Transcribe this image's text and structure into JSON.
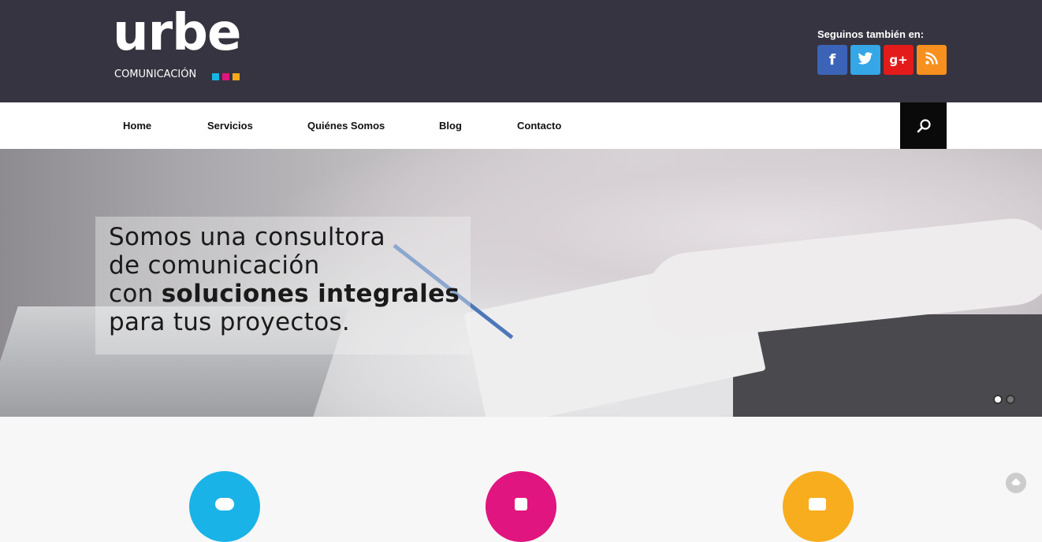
{
  "header": {
    "logo_word": "urbe",
    "logo_sub": "COMUNICACIÓN",
    "follow_label": "Seguinos también en:",
    "social": [
      {
        "name": "facebook",
        "glyph": "f",
        "color": "#3b64b8"
      },
      {
        "name": "twitter",
        "glyph": "t",
        "color": "#35a6e6"
      },
      {
        "name": "google-plus",
        "glyph": "g+",
        "color": "#e31b1b"
      },
      {
        "name": "rss",
        "glyph": "rss",
        "color": "#f7901e"
      }
    ]
  },
  "nav": {
    "items": [
      "Home",
      "Servicios",
      "Quiénes Somos",
      "Blog",
      "Contacto"
    ],
    "search_icon": "search-icon"
  },
  "hero": {
    "line1": "Somos una consultora",
    "line2": "de comunicación",
    "line3_prefix": "con ",
    "line3_bold": "soluciones integrales",
    "line4": "para tus proyectos.",
    "slides": 2,
    "active_slide": 1
  },
  "features": [
    {
      "color": "#1ab3e7",
      "icon": "chat-icon"
    },
    {
      "color": "#e0157f",
      "icon": "thumbs-up-icon"
    },
    {
      "color": "#f7ad1e",
      "icon": "video-camera-icon"
    }
  ]
}
